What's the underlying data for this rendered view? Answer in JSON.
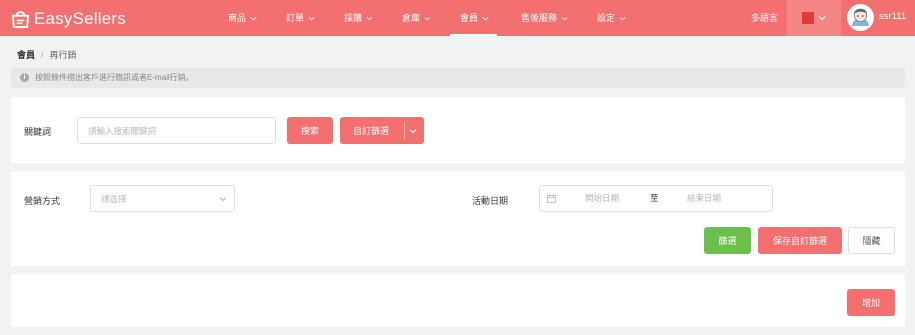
{
  "header": {
    "logo_text": "EasySellers",
    "nav": [
      {
        "label": "商品"
      },
      {
        "label": "訂單"
      },
      {
        "label": "採購"
      },
      {
        "label": "倉庫"
      },
      {
        "label": "會員"
      },
      {
        "label": "售後服務"
      },
      {
        "label": "設定"
      }
    ],
    "active_nav": "會員",
    "language_label": "多語言",
    "username": "ssr111"
  },
  "breadcrumb": {
    "root": "會員",
    "separator": "/",
    "current": "再行銷"
  },
  "info": {
    "text": "按照條件撈出客戶進行簡訊或者E-mail行銷。",
    "icon": "info-icon"
  },
  "search_panel": {
    "keyword_label": "關鍵詞",
    "keyword_placeholder": "請輸入搜索關鍵詞",
    "search_button": "搜索",
    "custom_filter_button": "自訂篩選"
  },
  "filter_panel": {
    "marketing_method_label": "營銷方式",
    "marketing_method_placeholder": "請选择",
    "activity_date_label": "活動日期",
    "start_date_placeholder": "開始日期",
    "date_separator": "至",
    "end_date_placeholder": "結束日期",
    "filter_button": "篩選",
    "save_custom_filter_button": "保存自訂篩選",
    "hide_button": "隱藏"
  },
  "list_panel": {
    "add_button": "增加"
  },
  "colors": {
    "brand": "#f46f6f",
    "success": "#6cc04a",
    "background": "#f1f2f4"
  }
}
